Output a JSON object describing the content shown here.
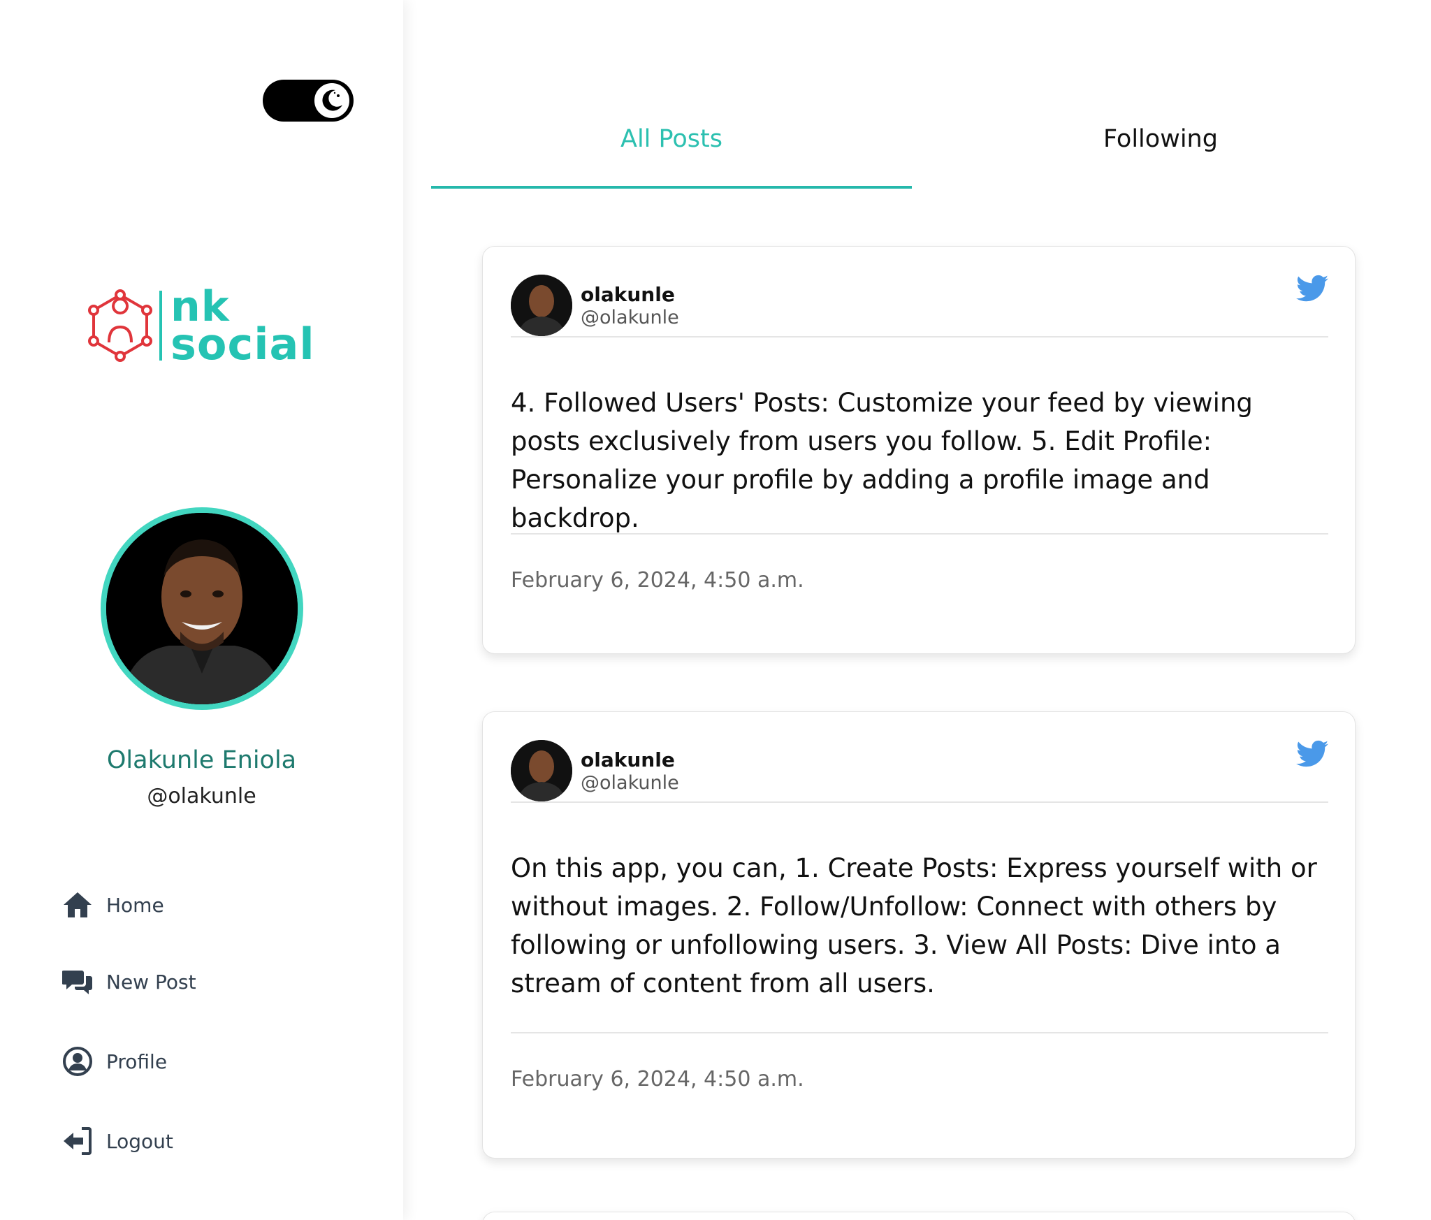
{
  "theme_toggle": {
    "icon": "moon-icon",
    "state": "dark-mode-toggle"
  },
  "brand": {
    "line1": "nk",
    "line2": "social",
    "accent": "#25c3b3",
    "mark_color": "#e0353b"
  },
  "profile": {
    "name": "Olakunle Eniola",
    "handle": "@olakunle"
  },
  "nav": [
    {
      "label": "Home",
      "icon": "home-icon"
    },
    {
      "label": "New Post",
      "icon": "comments-icon"
    },
    {
      "label": "Profile",
      "icon": "user-circle-icon"
    },
    {
      "label": "Logout",
      "icon": "logout-icon"
    }
  ],
  "tabs": [
    {
      "label": "All Posts",
      "active": true
    },
    {
      "label": "Following",
      "active": false
    }
  ],
  "posts": [
    {
      "username": "olakunle",
      "handle": "@olakunle",
      "body": "4. Followed Users' Posts: Customize your feed by viewing posts exclusively from users you follow. 5. Edit Profile: Personalize your profile by adding a profile image and backdrop.",
      "date": "February 6, 2024, 4:50 a.m."
    },
    {
      "username": "olakunle",
      "handle": "@olakunle",
      "body": "On this app, you can, 1. Create Posts: Express yourself with or without images. 2. Follow/Unfollow: Connect with others by following or unfollowing users. 3. View All Posts: Dive into a stream of content from all users.",
      "date": "February 6, 2024, 4:50 a.m."
    }
  ],
  "colors": {
    "accent_teal": "#2cc0b0",
    "twitter_blue": "#4a99e9",
    "nav_text": "#33404f"
  }
}
